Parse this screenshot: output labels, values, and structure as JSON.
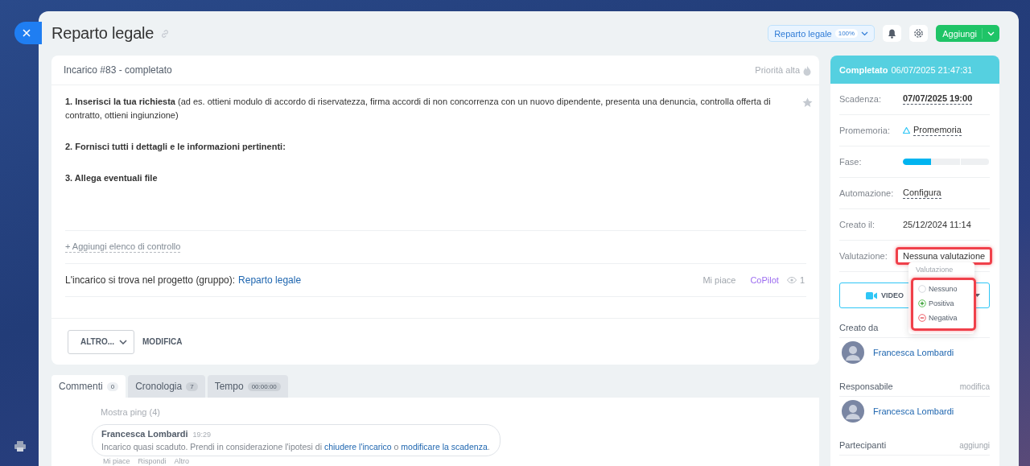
{
  "header": {
    "title": "Reparto legale",
    "group_button": {
      "label": "Reparto legale",
      "badge": "100%"
    },
    "add_button": "Aggiungi"
  },
  "task": {
    "title": "Incarico #83 - completato",
    "priority": "Priorità alta",
    "description": [
      {
        "text": "**1. Inserisci la tua richiesta** (ad es. ottieni modulo di accordo di riservatezza, firma accordi di non concorrenza con un nuovo dipendente, presenta una denuncia, controlla offerta di contratto, ottieni ingiunzione)",
        "bold": false
      },
      {
        "text": "2. Fornisci tutti i dettagli e le informazioni pertinenti:",
        "bold": true
      },
      {
        "text": "3. Allega eventuali file",
        "bold": true
      }
    ],
    "checklist_link": "+ Aggiungi elenco di controllo",
    "project": {
      "label": "L'incarico si trova nel progetto (gruppo):",
      "link": "Reparto legale"
    },
    "like": "Mi piace",
    "copilot": "CoPilot",
    "views": "1",
    "buttons": {
      "more": "ALTRO...",
      "edit": "MODIFICA"
    }
  },
  "tabs": [
    {
      "label": "Commenti",
      "count": "0",
      "selected": true
    },
    {
      "label": "Cronologia",
      "count": "7",
      "selected": false
    },
    {
      "label": "Tempo",
      "count": "00:00:00",
      "selected": false
    }
  ],
  "comments": {
    "show_pings": "Mostra ping (4)",
    "items": [
      {
        "author": "Francesca Lombardi",
        "time": "19:29",
        "parts": [
          {
            "text": "Incarico quasi scaduto. Prendi in considerazione l'ipotesi di ",
            "link": false
          },
          {
            "text": "chiudere l'incarico",
            "link": true
          },
          {
            "text": " o ",
            "link": false
          },
          {
            "text": "modificare la scadenza",
            "link": true
          },
          {
            "text": ".",
            "link": false
          }
        ],
        "actions": [
          "Mi piace",
          "Rispondi",
          "Altro"
        ]
      }
    ]
  },
  "sidebar": {
    "status": {
      "label": "Completato",
      "date": "06/07/2025 21:47:31"
    },
    "fields": [
      {
        "kind": "date",
        "label": "Scadenza:",
        "value": "07/07/2025 19:00"
      },
      {
        "kind": "reminder",
        "label": "Promemoria:",
        "value": "Promemoria"
      },
      {
        "kind": "stage",
        "label": "Fase:",
        "level": 0.33
      },
      {
        "kind": "link",
        "label": "Automazione:",
        "value": "Configura"
      },
      {
        "kind": "text",
        "label": "Creato il:",
        "value": "25/12/2024 11:14"
      },
      {
        "kind": "rating",
        "label": "Valutazione:",
        "value": "Nessuna valutazione"
      }
    ],
    "video_button": "VIDEO",
    "rating_menu": {
      "title": "Valutazione",
      "options": [
        {
          "kind": "none",
          "label": "Nessuno"
        },
        {
          "kind": "positive",
          "label": "Positiva"
        },
        {
          "kind": "negative",
          "label": "Negativa"
        }
      ]
    },
    "people": [
      {
        "label": "Creato da",
        "name": "Francesca Lombardi"
      },
      {
        "label": "Responsabile",
        "action": "modifica",
        "name": "Francesca Lombardi"
      },
      {
        "label": "Partecipanti",
        "action": "aggiungi"
      }
    ]
  }
}
